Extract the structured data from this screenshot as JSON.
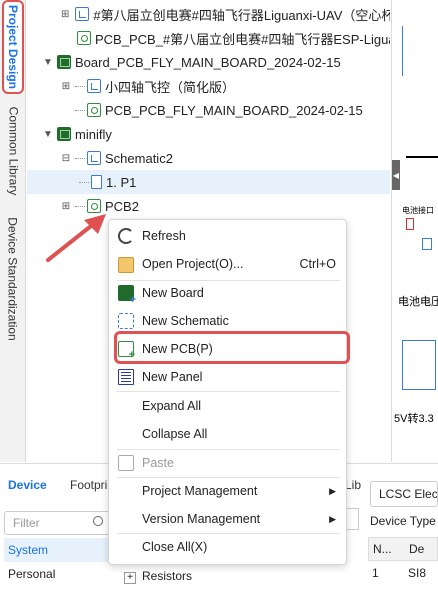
{
  "vtabs": [
    {
      "label": "Project Design",
      "active": true
    },
    {
      "label": "Common Library",
      "active": false
    },
    {
      "label": "Device Standardization",
      "active": false
    }
  ],
  "tree": {
    "rows": [
      {
        "label": "#第八届立创电赛#四轴飞行器Liguanxi-UAV（空心杯无",
        "icon": "schematic-icon"
      },
      {
        "label": "PCB_PCB_#第八届立创电赛#四轴飞行器ESP-Liguanxi_",
        "icon": "pcb-icon"
      },
      {
        "label": "Board_PCB_FLY_MAIN_BOARD_2024-02-15",
        "icon": "board-icon"
      },
      {
        "label": "小四轴飞控（简化版）",
        "icon": "schematic-icon"
      },
      {
        "label": "PCB_PCB_FLY_MAIN_BOARD_2024-02-15",
        "icon": "pcb-icon"
      },
      {
        "label": "minifly",
        "icon": "board-icon"
      },
      {
        "label": "Schematic2",
        "icon": "schematic-icon"
      },
      {
        "label": "1. P1",
        "icon": "page-icon"
      },
      {
        "label": "PCB2",
        "icon": "pcb-icon"
      }
    ]
  },
  "canvas": {
    "text1": "电池接口",
    "text2": "电池电压",
    "text3": "5V转3.3"
  },
  "context_menu": {
    "items": [
      {
        "label": "Refresh",
        "icon": "refresh-icon",
        "shortcut": "",
        "submenu": false,
        "disabled": false
      },
      {
        "label": "Open Project(O)...",
        "icon": "folder-icon",
        "shortcut": "Ctrl+O",
        "submenu": false,
        "disabled": false
      },
      {
        "label": "New Board",
        "icon": "new-board-icon",
        "shortcut": "",
        "submenu": false,
        "disabled": false
      },
      {
        "label": "New Schematic",
        "icon": "new-schematic-icon",
        "shortcut": "",
        "submenu": false,
        "disabled": false
      },
      {
        "label": "New PCB(P)",
        "icon": "new-pcb-icon",
        "shortcut": "",
        "submenu": false,
        "disabled": false
      },
      {
        "label": "New Panel",
        "icon": "new-panel-icon",
        "shortcut": "",
        "submenu": false,
        "disabled": false
      },
      {
        "label": "Expand All",
        "icon": "",
        "shortcut": "",
        "submenu": false,
        "disabled": false
      },
      {
        "label": "Collapse All",
        "icon": "",
        "shortcut": "",
        "submenu": false,
        "disabled": false
      },
      {
        "label": "Paste",
        "icon": "paste-icon",
        "shortcut": "",
        "submenu": false,
        "disabled": true
      },
      {
        "label": "Project Management",
        "icon": "",
        "shortcut": "",
        "submenu": true,
        "disabled": false
      },
      {
        "label": "Version Management",
        "icon": "",
        "shortcut": "",
        "submenu": true,
        "disabled": false
      },
      {
        "label": "Close All(X)",
        "icon": "",
        "shortcut": "",
        "submenu": false,
        "disabled": false
      }
    ]
  },
  "bottom": {
    "tabs": [
      "Device",
      "Footpri",
      "Lib"
    ],
    "filter_placeholder": "Filter",
    "categories": [
      "System",
      "Personal"
    ],
    "lcsc_label": "LCSC Elec",
    "device_type_label": "Device Type",
    "resistors_label": "Resistors",
    "table_header": [
      "N...",
      "De"
    ],
    "table_row": [
      "1",
      "SI8"
    ]
  },
  "colors": {
    "accent": "#1a73e8",
    "highlight": "#e05252",
    "selected_bg": "#e6f1fb"
  }
}
